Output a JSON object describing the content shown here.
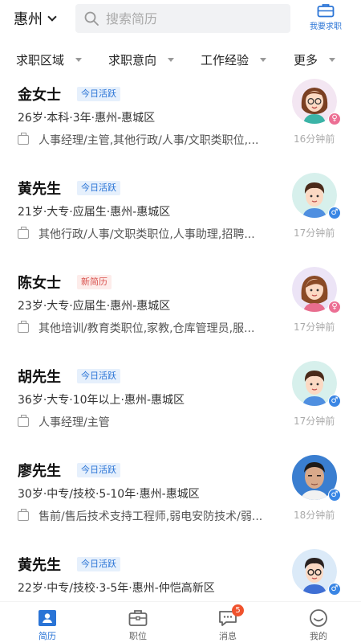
{
  "header": {
    "city": "惠州",
    "search_placeholder": "搜索简历",
    "job_button_label": "我要求职"
  },
  "filters": [
    {
      "label": "求职区域"
    },
    {
      "label": "求职意向"
    },
    {
      "label": "工作经验"
    },
    {
      "label": "更多"
    }
  ],
  "resumes": [
    {
      "name": "金女士",
      "tag": "今日活跃",
      "info": "26岁·本科·3年·惠州-惠城区",
      "jobs": "人事经理/主管,其他行政/人事/文职类职位,...",
      "time": "16分钟前",
      "gender": "♀"
    },
    {
      "name": "黄先生",
      "tag": "今日活跃",
      "info": "21岁·大专·应届生·惠州-惠城区",
      "jobs": "其他行政/人事/文职类职位,人事助理,招聘...",
      "time": "17分钟前",
      "gender": "♂"
    },
    {
      "name": "陈女士",
      "tag": "新简历",
      "info": "23岁·大专·应届生·惠州-惠城区",
      "jobs": "其他培训/教育类职位,家教,仓库管理员,服...",
      "time": "17分钟前",
      "gender": "♀"
    },
    {
      "name": "胡先生",
      "tag": "今日活跃",
      "info": "36岁·大专·10年以上·惠州-惠城区",
      "jobs": "人事经理/主管",
      "time": "17分钟前",
      "gender": "♂"
    },
    {
      "name": "廖先生",
      "tag": "今日活跃",
      "info": "30岁·中专/技校·5-10年·惠州-惠城区",
      "jobs": "售前/售后技术支持工程师,弱电安防技术/弱...",
      "time": "18分钟前",
      "gender": "♂"
    },
    {
      "name": "黄先生",
      "tag": "今日活跃",
      "info": "22岁·中专/技校·3-5年·惠州-仲恺高新区",
      "jobs": "",
      "time": "",
      "gender": "♂"
    }
  ],
  "nav": [
    {
      "label": "简历",
      "icon": "resume-icon"
    },
    {
      "label": "职位",
      "icon": "briefcase-icon"
    },
    {
      "label": "消息",
      "icon": "message-icon",
      "badge": "5"
    },
    {
      "label": "我的",
      "icon": "profile-icon"
    }
  ],
  "colors": {
    "accent": "#2a74d6",
    "badge": "#f0522d"
  }
}
